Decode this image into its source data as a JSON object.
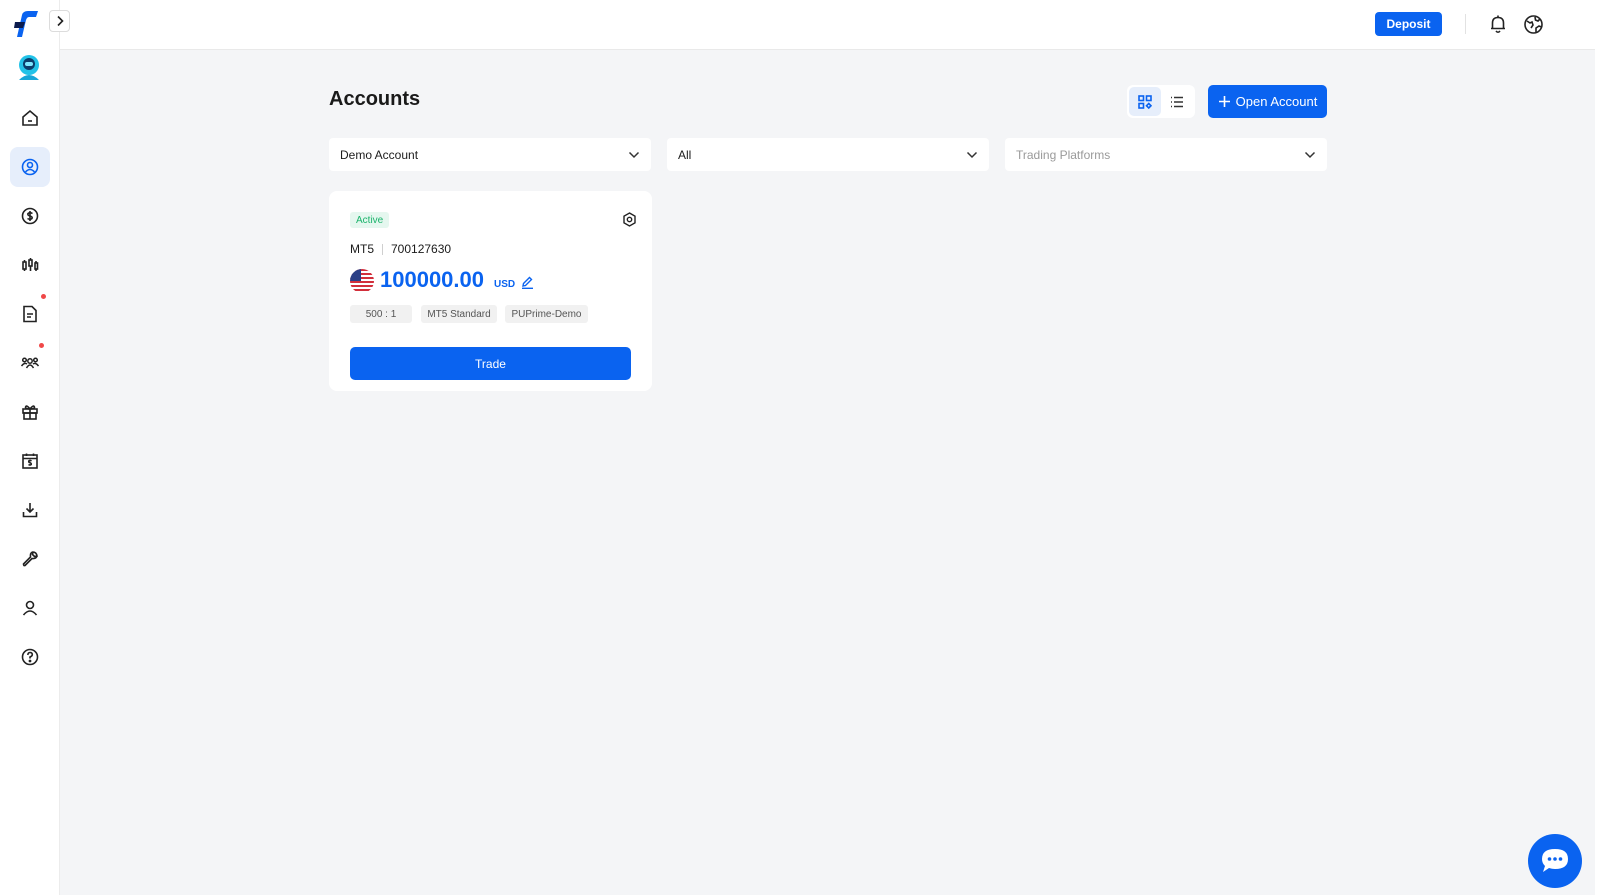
{
  "header": {
    "deposit_label": "Deposit"
  },
  "main": {
    "title": "Accounts",
    "open_account_label": "Open Account",
    "filters": [
      {
        "value": "Demo Account",
        "placeholder": ""
      },
      {
        "value": "All",
        "placeholder": ""
      },
      {
        "value": "",
        "placeholder": "Trading Platforms"
      }
    ],
    "view_modes": [
      "grid",
      "list"
    ],
    "active_view": "grid"
  },
  "account_card": {
    "status": "Active",
    "platform": "MT5",
    "account_number": "700127630",
    "balance": "100000.00",
    "currency": "USD",
    "tags": [
      "500 : 1",
      "MT5 Standard",
      "PUPrime-Demo"
    ],
    "trade_label": "Trade"
  },
  "sidebar": {
    "items": [
      {
        "icon": "home-icon"
      },
      {
        "icon": "account-icon",
        "active": true
      },
      {
        "icon": "dollar-icon"
      },
      {
        "icon": "chart-candles-icon"
      },
      {
        "icon": "document-icon",
        "notification": true
      },
      {
        "icon": "team-icon",
        "notification": true
      },
      {
        "icon": "gift-icon"
      },
      {
        "icon": "calendar-money-icon"
      },
      {
        "icon": "download-icon"
      },
      {
        "icon": "wrench-icon"
      },
      {
        "icon": "user-icon"
      },
      {
        "icon": "help-icon"
      }
    ]
  },
  "colors": {
    "primary": "#0a63f0",
    "active_badge_bg": "#e5f7ef",
    "active_badge_text": "#1bb36b",
    "notification": "#f04848",
    "background": "#f4f5f7"
  }
}
